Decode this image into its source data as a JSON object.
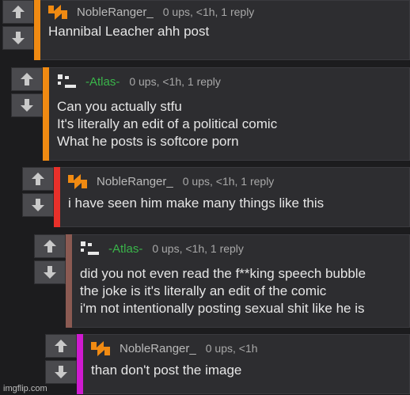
{
  "colors": {
    "orange": "#f08a12",
    "red": "#e8302a",
    "brown": "#8b5a52",
    "magenta": "#cf1ad0",
    "green": "#3ab54a"
  },
  "comments": [
    {
      "user": "NobleRanger_",
      "meta": "0 ups, <1h, 1 reply",
      "lines": [
        "Hannibal Leacher ahh post"
      ],
      "avatar": "noble-logo-icon"
    },
    {
      "user": "-Atlas-",
      "meta": "0 ups, <1h, 1 reply",
      "lines": [
        "Can you actually stfu",
        "It's literally an edit of a political comic",
        "What he posts is softcore porn"
      ],
      "avatar": "atlas-pixel-icon"
    },
    {
      "user": "NobleRanger_",
      "meta": "0 ups, <1h, 1 reply",
      "lines": [
        "i have seen him make many things like this"
      ],
      "avatar": "noble-logo-icon"
    },
    {
      "user": "-Atlas-",
      "meta": "0 ups, <1h, 1 reply",
      "lines": [
        "did you not even read the f**king speech bubble",
        "the joke is it's literally an edit of the comic",
        "i'm not intentionally posting sexual shit like he is"
      ],
      "avatar": "atlas-pixel-icon"
    },
    {
      "user": "NobleRanger_",
      "meta": "0 ups, <1h",
      "lines": [
        "than don't post the image"
      ],
      "avatar": "noble-logo-icon"
    }
  ],
  "footer": "imgflip.com"
}
